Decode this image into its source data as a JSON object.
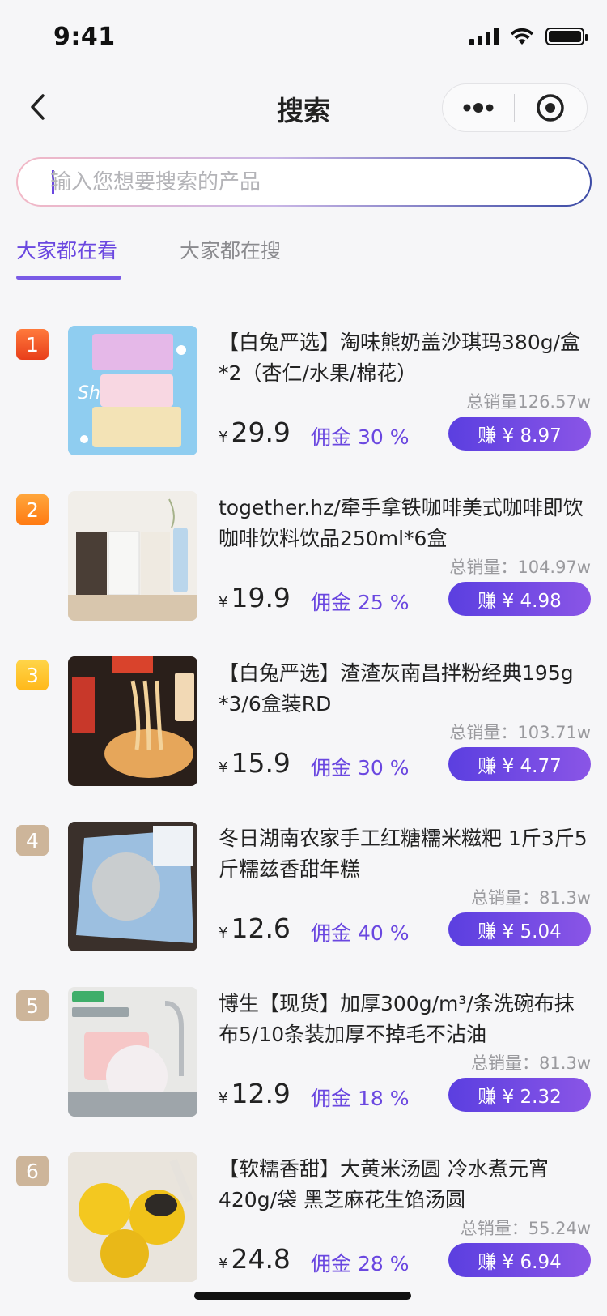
{
  "status_bar": {
    "time": "9:41"
  },
  "nav": {
    "title": "搜索",
    "back_icon": "chevron-left-icon",
    "more_icon": "more-dots-icon",
    "close_icon": "target-close-icon"
  },
  "search": {
    "placeholder": "输入您想要搜索的产品",
    "value": ""
  },
  "tabs": [
    {
      "label": "大家都在看",
      "active": true
    },
    {
      "label": "大家都在搜",
      "active": false
    }
  ],
  "colors": {
    "accent": "#6a47e0",
    "rank1": "#f05a1e",
    "rank2": "#ff8a1a",
    "rank3": "#ffc21f",
    "rank_other": "#cdb59a"
  },
  "products": [
    {
      "rank": "1",
      "title": "【白兔严选】淘味熊奶盖沙琪玛380g/盒*2（杏仁/水果/棉花）",
      "sales": "总销量126.57w",
      "currency": "¥",
      "price": "29.9",
      "commission": "佣金 30 %",
      "earn": "赚 ¥ 8.97"
    },
    {
      "rank": "2",
      "title": "together.hz/牵手拿铁咖啡美式咖啡即饮咖啡饮料饮品250ml*6盒",
      "sales": "总销量：104.97w",
      "currency": "¥",
      "price": "19.9",
      "commission": "佣金 25 %",
      "earn": "赚 ¥ 4.98"
    },
    {
      "rank": "3",
      "title": "【白兔严选】渣渣灰南昌拌粉经典195g *3/6盒装RD",
      "sales": "总销量：103.71w",
      "currency": "¥",
      "price": "15.9",
      "commission": "佣金 30 %",
      "earn": "赚 ¥ 4.77"
    },
    {
      "rank": "4",
      "title": "冬日湖南农家手工红糖糯米糍粑 1斤3斤5斤糯兹香甜年糕",
      "sales": "总销量：81.3w",
      "currency": "¥",
      "price": "12.6",
      "commission": "佣金 40 %",
      "earn": "赚 ¥ 5.04"
    },
    {
      "rank": "5",
      "title": "博生【现货】加厚300g/m³/条洗碗布抹布5/10条装加厚不掉毛不沾油",
      "sales": "总销量：81.3w",
      "currency": "¥",
      "price": "12.9",
      "commission": "佣金 18 %",
      "earn": "赚 ¥ 2.32"
    },
    {
      "rank": "6",
      "title": "【软糯香甜】大黄米汤圆 冷水煮元宵420g/袋 黑芝麻花生馅汤圆",
      "sales": "总销量：55.24w",
      "currency": "¥",
      "price": "24.8",
      "commission": "佣金 28 %",
      "earn": "赚 ¥ 6.94"
    }
  ]
}
